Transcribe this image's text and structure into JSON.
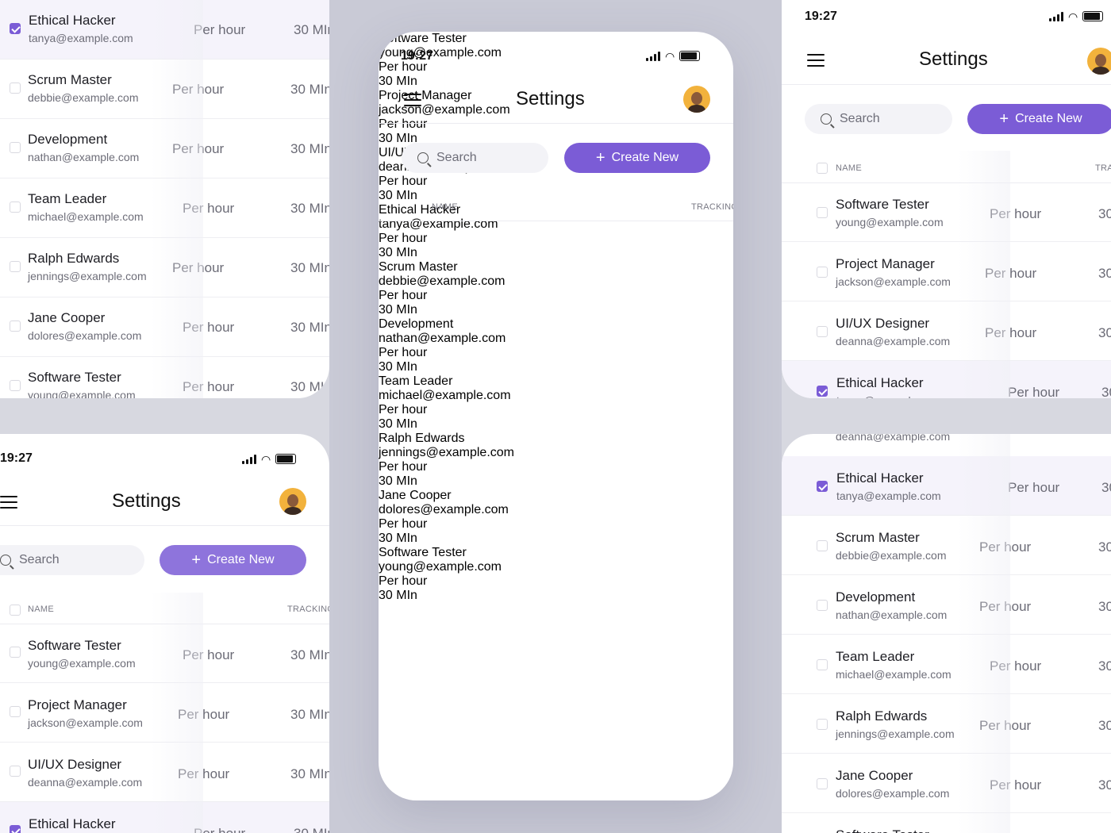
{
  "app": {
    "time": "19:27",
    "title": "Settings"
  },
  "search": {
    "placeholder": "Search"
  },
  "create_button": {
    "label": "Create New"
  },
  "table": {
    "col_name": "NAME",
    "col_tracking": "TRACKING"
  },
  "rate_suffix": "Per hour",
  "tracking_value": "30 MIn",
  "people": [
    {
      "name": "Software Tester",
      "email": "young@example.com"
    },
    {
      "name": "Project Manager",
      "email": "jackson@example.com"
    },
    {
      "name": "UI/UX Designer",
      "email": "deanna@example.com"
    },
    {
      "name": "Ethical Hacker",
      "email": "tanya@example.com",
      "selected": true
    },
    {
      "name": "Scrum Master",
      "email": "debbie@example.com"
    },
    {
      "name": "Development",
      "email": "nathan@example.com"
    },
    {
      "name": "Team Leader",
      "email": "michael@example.com"
    },
    {
      "name": "Ralph Edwards",
      "email": "jennings@example.com"
    },
    {
      "name": "Jane Cooper",
      "email": "dolores@example.com"
    },
    {
      "name": "Software Tester",
      "email": "young@example.com"
    }
  ],
  "colors": {
    "accent": "#7b5cd6",
    "background": "#c9cad6"
  }
}
